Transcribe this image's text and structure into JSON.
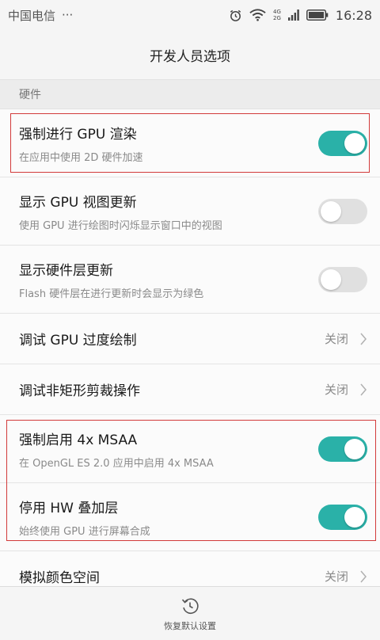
{
  "status_bar": {
    "carrier": "中国电信",
    "more": "···",
    "network_type_top": "4G",
    "network_type_bottom": "2G",
    "time": "16:28"
  },
  "header": {
    "title": "开发人员选项"
  },
  "section": {
    "label": "硬件"
  },
  "items": [
    {
      "title": "强制进行 GPU 渲染",
      "subtitle": "在应用中使用 2D 硬件加速",
      "toggle": "on"
    },
    {
      "title": "显示 GPU 视图更新",
      "subtitle": "使用 GPU 进行绘图时闪烁显示窗口中的视图",
      "toggle": "off"
    },
    {
      "title": "显示硬件层更新",
      "subtitle": "Flash 硬件层在进行更新时会显示为绿色",
      "toggle": "off"
    },
    {
      "title": "调试 GPU 过度绘制",
      "value": "关闭"
    },
    {
      "title": "调试非矩形剪裁操作",
      "value": "关闭"
    },
    {
      "title": "强制启用 4x MSAA",
      "subtitle": "在 OpenGL ES 2.0 应用中启用 4x MSAA",
      "toggle": "on"
    },
    {
      "title": "停用 HW 叠加层",
      "subtitle": "始终使用 GPU 进行屏幕合成",
      "toggle": "on"
    },
    {
      "title": "模拟颜色空间",
      "value": "关闭"
    }
  ],
  "bottom_bar": {
    "label": "恢复默认设置"
  },
  "colors": {
    "accent": "#2ab1a8",
    "highlight_border": "#d23a3a"
  }
}
